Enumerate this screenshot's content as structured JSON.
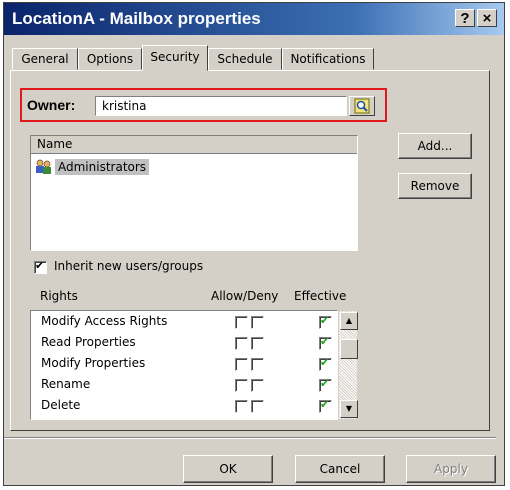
{
  "window": {
    "title": "LocationA - Mailbox properties",
    "help_label": "?",
    "close_label": "×"
  },
  "tabs": [
    {
      "label": "General",
      "active": false
    },
    {
      "label": "Options",
      "active": false
    },
    {
      "label": "Security",
      "active": true
    },
    {
      "label": "Schedule",
      "active": false
    },
    {
      "label": "Notifications",
      "active": false
    }
  ],
  "owner": {
    "label": "Owner:",
    "value": "kristina",
    "browse_icon": "search-user-icon"
  },
  "users_list": {
    "header": "Name",
    "items": [
      {
        "name": "Administrators",
        "icon": "group-icon"
      }
    ]
  },
  "buttons": {
    "add": "Add...",
    "remove": "Remove",
    "ok": "OK",
    "cancel": "Cancel",
    "apply": "Apply"
  },
  "inherit": {
    "label": "Inherit new users/groups",
    "checked": true
  },
  "rights": {
    "headers": {
      "rights": "Rights",
      "allow_deny": "Allow/Deny",
      "effective": "Effective"
    },
    "items": [
      {
        "name": "Modify Access Rights",
        "allow": false,
        "deny": false,
        "effective": true
      },
      {
        "name": "Read Properties",
        "allow": false,
        "deny": false,
        "effective": true
      },
      {
        "name": "Modify Properties",
        "allow": false,
        "deny": false,
        "effective": true
      },
      {
        "name": "Rename",
        "allow": false,
        "deny": false,
        "effective": true
      },
      {
        "name": "Delete",
        "allow": false,
        "deny": false,
        "effective": true
      }
    ]
  },
  "colors": {
    "highlight_box": "#e0191d",
    "effective_check": "#1aa31a"
  }
}
